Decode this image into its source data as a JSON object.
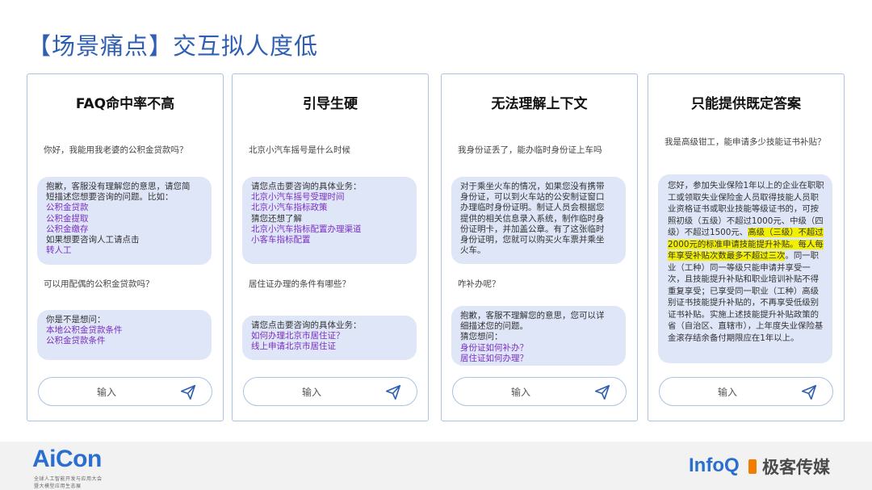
{
  "slide": {
    "title": "【场景痛点】交互拟人度低"
  },
  "cards": [
    {
      "title": "FAQ命中率不高",
      "q1": "你好，我能用我老婆的公积金贷款吗？",
      "a1": {
        "lines": [
          "抱歉，客服没有理解您的意思，请您简",
          "短描述您想要咨询的问题。比如："
        ],
        "links": [
          "公积金贷款",
          "公积金提取",
          "公积金缴存"
        ],
        "tail": "如果想要咨询人工请点击",
        "tail_link": "转人工"
      },
      "q2": "可以用配偶的公积金贷款吗？",
      "a2": {
        "lines": [
          "你是不是想问："
        ],
        "links": [
          "本地公积金贷款条件",
          "公积金贷款条件"
        ]
      },
      "input_label": "输入"
    },
    {
      "title": "引导生硬",
      "q1": "北京小汽车摇号是什么时候",
      "a1": {
        "lines": [
          "请您点击要咨询的具体业务："
        ],
        "links": [
          "北京小汽车摇号受理时间",
          "北京小汽车指标政策"
        ],
        "mid": "猜您还想了解",
        "links2": [
          "北京小汽车指标配置办理渠道",
          "小客车指标配置"
        ]
      },
      "q2": "居住证办理的条件有哪些？",
      "a2": {
        "lines": [
          "请您点击要咨询的具体业务："
        ],
        "links": [
          "如何办理北京市居住证？",
          "线上申请北京市居住证"
        ]
      },
      "input_label": "输入"
    },
    {
      "title": "无法理解上下文",
      "q1": "我身份证丢了，能办临时身份证上车吗",
      "a1": {
        "lines": [
          "对于乘坐火车的情况，如果您没有携带",
          "身份证，可以到火车站的公安制证窗口",
          "办理临时身份证明。制证人员会根据您",
          "提供的相关信息录入系统，制作临时身",
          "份证明卡，并加盖公章。有了这张临时",
          "身份证明，您就可以购买火车票并乘坐",
          "火车。"
        ]
      },
      "q2": "咋补办呢？",
      "a2": {
        "lines": [
          "抱歉，客服不理解您的意思，您可以详",
          "细描述您的问题。",
          "猜您想问："
        ],
        "links": [
          "身份证如何补办？",
          "居住证如何办理？"
        ]
      },
      "input_label": "输入"
    },
    {
      "title": "只能提供既定答案",
      "q1": "我是高级钳工，能申请多少技能证书补贴？",
      "a1": {
        "pre": "您好，参加失业保险1年以上的企业在职职工或领取失业保险金人员取得技能人员职业资格证书或职业技能等级证书的，可按照初级（五级）不超过1000元、中级（四级）不超过1500元、",
        "highlight": "高级（三级）不超过2000元的标准申请技能提升补贴。每人每年享受补贴次数最多不超过三次",
        "post": "。同一职业（工种）同一等级只能申请并享受一次，且技能提升补贴和职业培训补贴不得重复享受；已享受同一职业（工种）高级别证书技能提升补贴的，不再享受低级别证书补贴。实施上述技能提升补贴政策的省（自治区、直辖市），上年度失业保险基金滚存结余备付期限应在1年以上。"
      },
      "input_label": "输入"
    }
  ],
  "footer": {
    "aicon_logo": "AiCon",
    "aicon_line1": "全球人工智能开发与应用大会",
    "aicon_line2": "暨大模型应用生态展",
    "infoq_logo": "InfoQ",
    "geek_logo": "极客传媒"
  },
  "colors": {
    "title": "#2f5fb3",
    "link": "#7a2fc0",
    "bubble": "#dfe6f8",
    "border": "#a9c3e4",
    "highlight": "#f2f000",
    "logo_blue": "#2a6fcf"
  },
  "icons": {
    "send": "send-plane-icon"
  }
}
